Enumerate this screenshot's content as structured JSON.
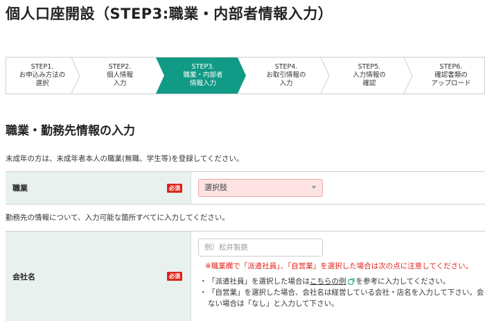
{
  "page_title": "個人口座開設（STEP3:職業・内部者情報入力）",
  "steps": [
    {
      "line1": "STEP1.",
      "line2": "お申込み方法の",
      "line3": "選択",
      "active": false
    },
    {
      "line1": "STEP2.",
      "line2": "個人情報",
      "line3": "入力",
      "active": false
    },
    {
      "line1": "STEP3.",
      "line2": "職業・内部者",
      "line3": "情報入力",
      "active": true
    },
    {
      "line1": "STEP4.",
      "line2": "お取引情報の",
      "line3": "入力",
      "active": false
    },
    {
      "line1": "STEP5.",
      "line2": "入力情報の",
      "line3": "確認",
      "active": false
    },
    {
      "line1": "STEP6.",
      "line2": "確認書類の",
      "line3": "アップロード",
      "active": false
    }
  ],
  "colors": {
    "active_step": "#119a85",
    "required": "#d9251d",
    "label_bg": "#e8f1ed",
    "select_bg": "#fde3e3",
    "warning": "#e0241a"
  },
  "section_title": "職業・勤務先情報の入力",
  "minor_note": "未成年の方は、未成年者本人の職業(無職、学生等)を登録してください。",
  "occupation": {
    "label": "職業",
    "required": "必須",
    "selected": "選択肢",
    "icon": "chevron-down-icon"
  },
  "workplace_note": "勤務先の情報について、入力可能な箇所すべてに入力してください。",
  "company": {
    "label": "会社名",
    "required": "必須",
    "placeholder": "例）松井製鉄",
    "warning": "※職業欄で「派遣社員」、「自営業」を選択した場合は次の点に注意してください。",
    "bullet1_before": "「派遣社員」を選択した場合は",
    "bullet1_link": "こちらの例",
    "bullet1_after": "を参考に入力してください。",
    "bullet2_line1": "「自営業」を選択した場合、会社名は経営している会社・店名を入力して下さい。会",
    "bullet2_line2": "ない場合は「なし」と入力して下さい。",
    "bullet_mark": "・",
    "link_icon": "external-link-icon"
  }
}
